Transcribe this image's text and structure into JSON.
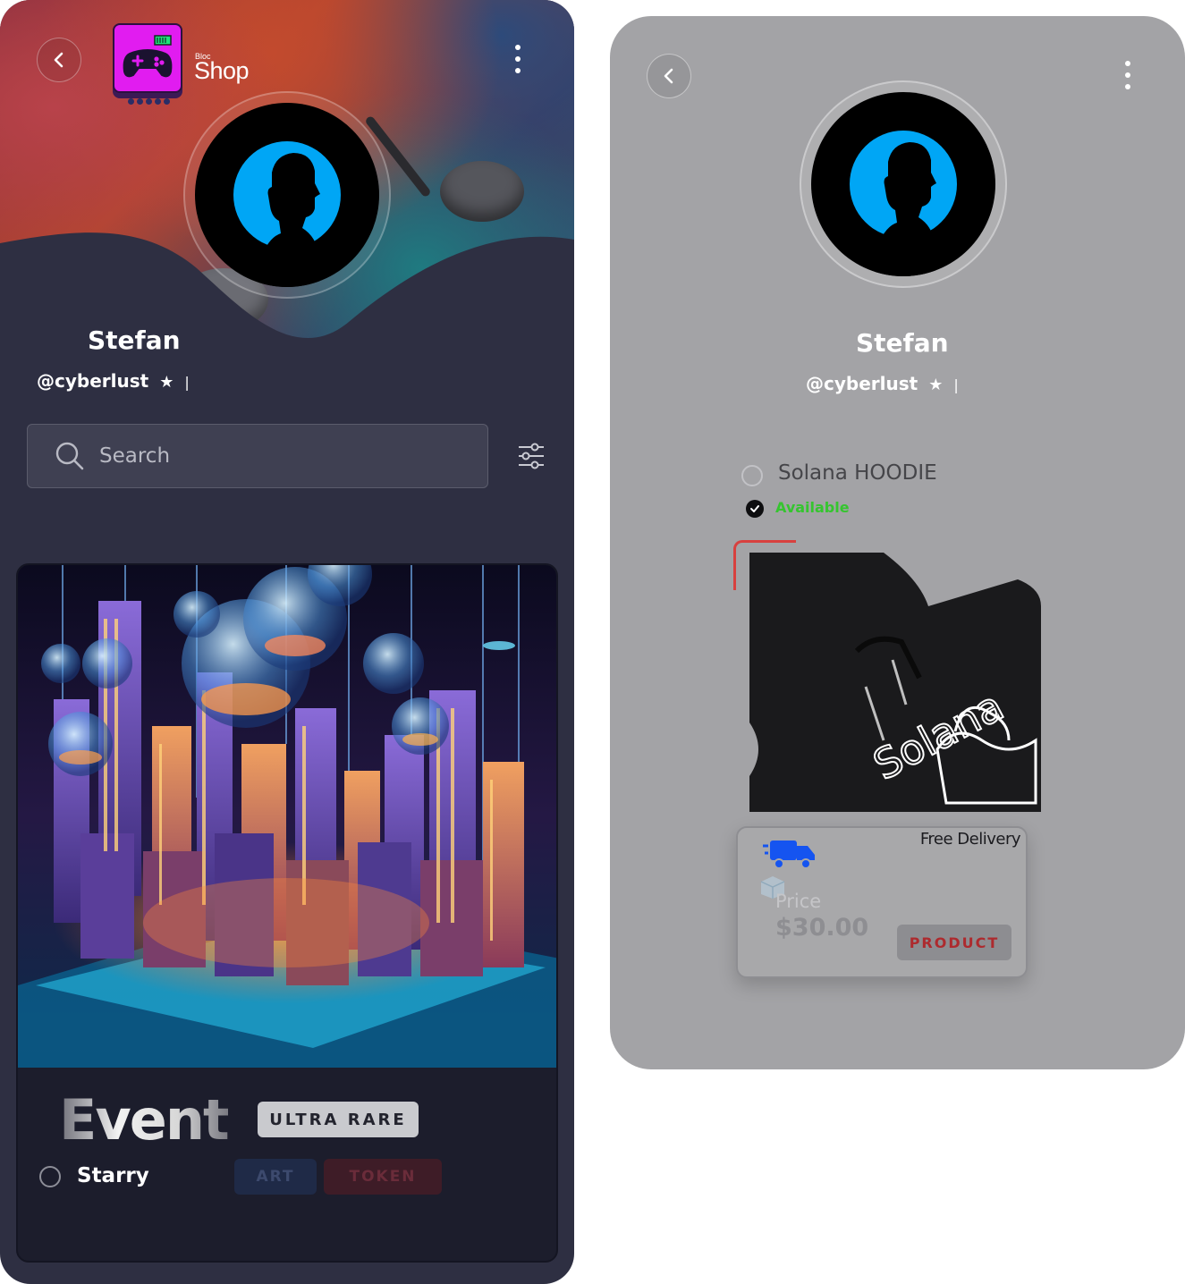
{
  "left_screen": {
    "brand": {
      "small_text": "Bloc",
      "name": "Shop"
    },
    "profile": {
      "name": "Stefan",
      "handle": "@cyberlust",
      "star": "★",
      "separator": "|"
    },
    "search": {
      "placeholder": "Search",
      "value": ""
    },
    "card": {
      "title": "Event",
      "rarity_badge": "ULTRA RARE",
      "item_name": "Starry",
      "tags": [
        "ART",
        "TOKEN"
      ]
    }
  },
  "right_screen": {
    "profile": {
      "name": "Stefan",
      "handle": "@cyberlust",
      "star": "★",
      "separator": "|"
    },
    "product": {
      "title": "Solana HOODIE",
      "status": "Available",
      "hoodie_print": "Solana",
      "delivery": "Free Delivery",
      "price_label": "Price",
      "price_value": "$30.00",
      "button": "PRODUCT"
    }
  },
  "colors": {
    "left_background": "#2e2f42",
    "right_background": "#a3a3a6",
    "logo_magenta": "#e11cf0",
    "avatar_blue": "#00a6f5",
    "available_green": "#35c52f",
    "accent_red": "#d8403f",
    "truck_blue": "#1554f0"
  },
  "icons": [
    "back-arrow-icon",
    "kebab-menu-icon",
    "gamepad-logo-icon",
    "search-icon",
    "filter-sliders-icon",
    "checkmark-icon",
    "truck-icon",
    "box-icon"
  ]
}
